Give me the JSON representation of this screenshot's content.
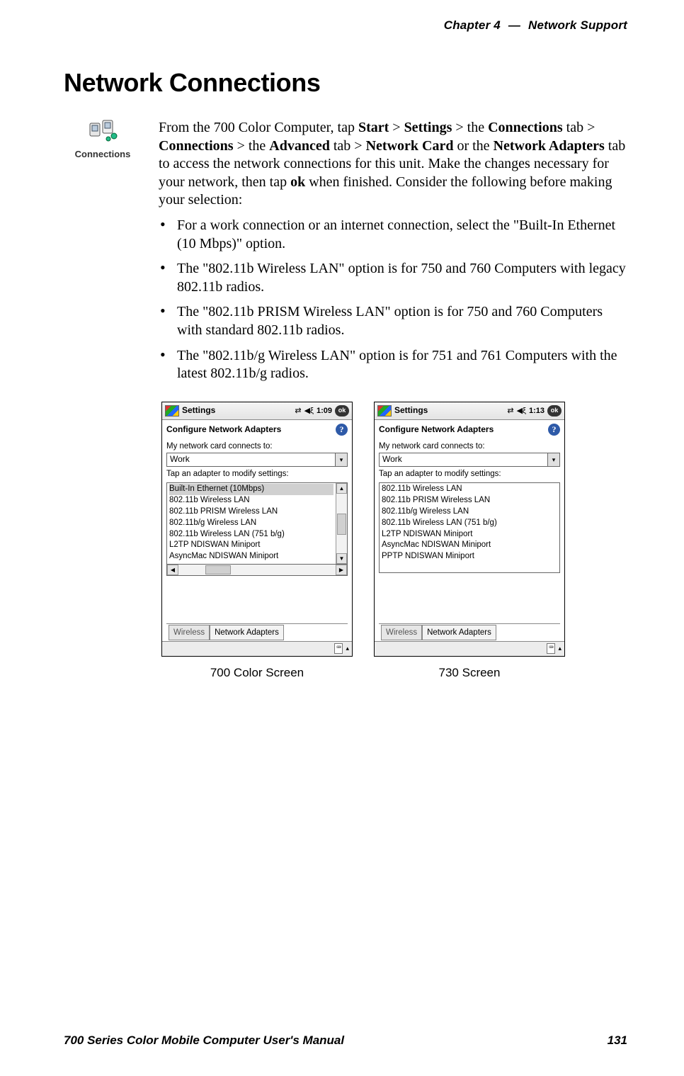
{
  "header": {
    "left": "Chapter  4",
    "dash": "—",
    "right": "Network Support"
  },
  "section_title": "Network Connections",
  "icon": {
    "caption": "Connections"
  },
  "intro": {
    "pre": "From the 700 Color Computer, tap ",
    "b1": "Start",
    "gt1": " > ",
    "b2": "Settings",
    "mid1": " > the ",
    "b3": "Connections",
    "mid2": " tab > ",
    "b4": "Connections",
    "mid3": " > the ",
    "b5": "Advanced",
    "mid4": " tab > ",
    "b6": "Network Card",
    "mid5": " or the ",
    "b7": "Network Adapters",
    "mid6": " tab to access the network connections for this unit. Make the changes necessary for your network, then tap ",
    "b8": "ok",
    "tail": " when finished. Consider the following before making your selection:"
  },
  "bullets": [
    "For a work connection or an internet connection, select the \"Built-In Ethernet (10 Mbps)\" option.",
    "The \"802.11b Wireless LAN\" option is for 750 and 760 Computers with legacy 802.11b radios.",
    "The \"802.11b PRISM Wireless LAN\" option is for 750 and 760 Computers with standard 802.11b radios.",
    "The \"802.11b/g Wireless LAN\" option is for 751 and 761 Computers with the latest 802.11b/g radios."
  ],
  "device_left": {
    "topbar_title": "Settings",
    "time": "1:09",
    "ok": "ok",
    "panel_title": "Configure Network Adapters",
    "label1": "My network card connects to:",
    "combo_value": "Work",
    "label2": "Tap an adapter to modify settings:",
    "adapters": [
      "Built-In Ethernet (10Mbps)",
      "802.11b Wireless LAN",
      "802.11b PRISM Wireless LAN",
      "802.11b/g Wireless LAN",
      "802.11b Wireless LAN (751 b/g)",
      "L2TP NDISWAN Miniport",
      "AsyncMac NDISWAN Miniport"
    ],
    "tabs": {
      "inactive": "Wireless",
      "active": "Network Adapters"
    },
    "caption": "700 Color Screen"
  },
  "device_right": {
    "topbar_title": "Settings",
    "time": "1:13",
    "ok": "ok",
    "panel_title": "Configure Network Adapters",
    "label1": "My network card connects to:",
    "combo_value": "Work",
    "label2": "Tap an adapter to modify settings:",
    "adapters": [
      "802.11b Wireless LAN",
      "802.11b PRISM Wireless LAN",
      "802.11b/g Wireless LAN",
      "802.11b Wireless LAN (751 b/g)",
      "L2TP NDISWAN Miniport",
      "AsyncMac NDISWAN Miniport",
      "PPTP NDISWAN Miniport"
    ],
    "tabs": {
      "inactive": "Wireless",
      "active": "Network Adapters"
    },
    "caption": "730 Screen"
  },
  "footer": {
    "left": "700 Series Color Mobile Computer User's Manual",
    "right": "131"
  }
}
